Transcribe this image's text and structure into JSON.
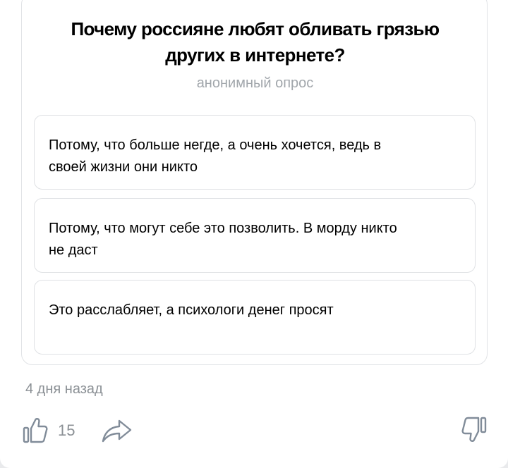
{
  "poll": {
    "question": "Почему россияне любят обливать грязью других в интернете?",
    "type_label": "анонимный опрос",
    "options": [
      {
        "label": "Потому, что больше негде, а очень хочется, ведь в своей жизни они никто"
      },
      {
        "label": "Потому, что могут себе это позволить.  В морду никто не даст"
      },
      {
        "label": "Это расслабляет, а психологи денег просят"
      }
    ]
  },
  "post": {
    "timestamp": "4 дня назад"
  },
  "actions": {
    "like_count": "15",
    "icons": [
      "like-icon",
      "share-icon",
      "dislike-icon"
    ]
  },
  "colors": {
    "text": "#000000",
    "muted": "#8b9095",
    "border": "#e1e3e6",
    "background": "#ffffff"
  }
}
